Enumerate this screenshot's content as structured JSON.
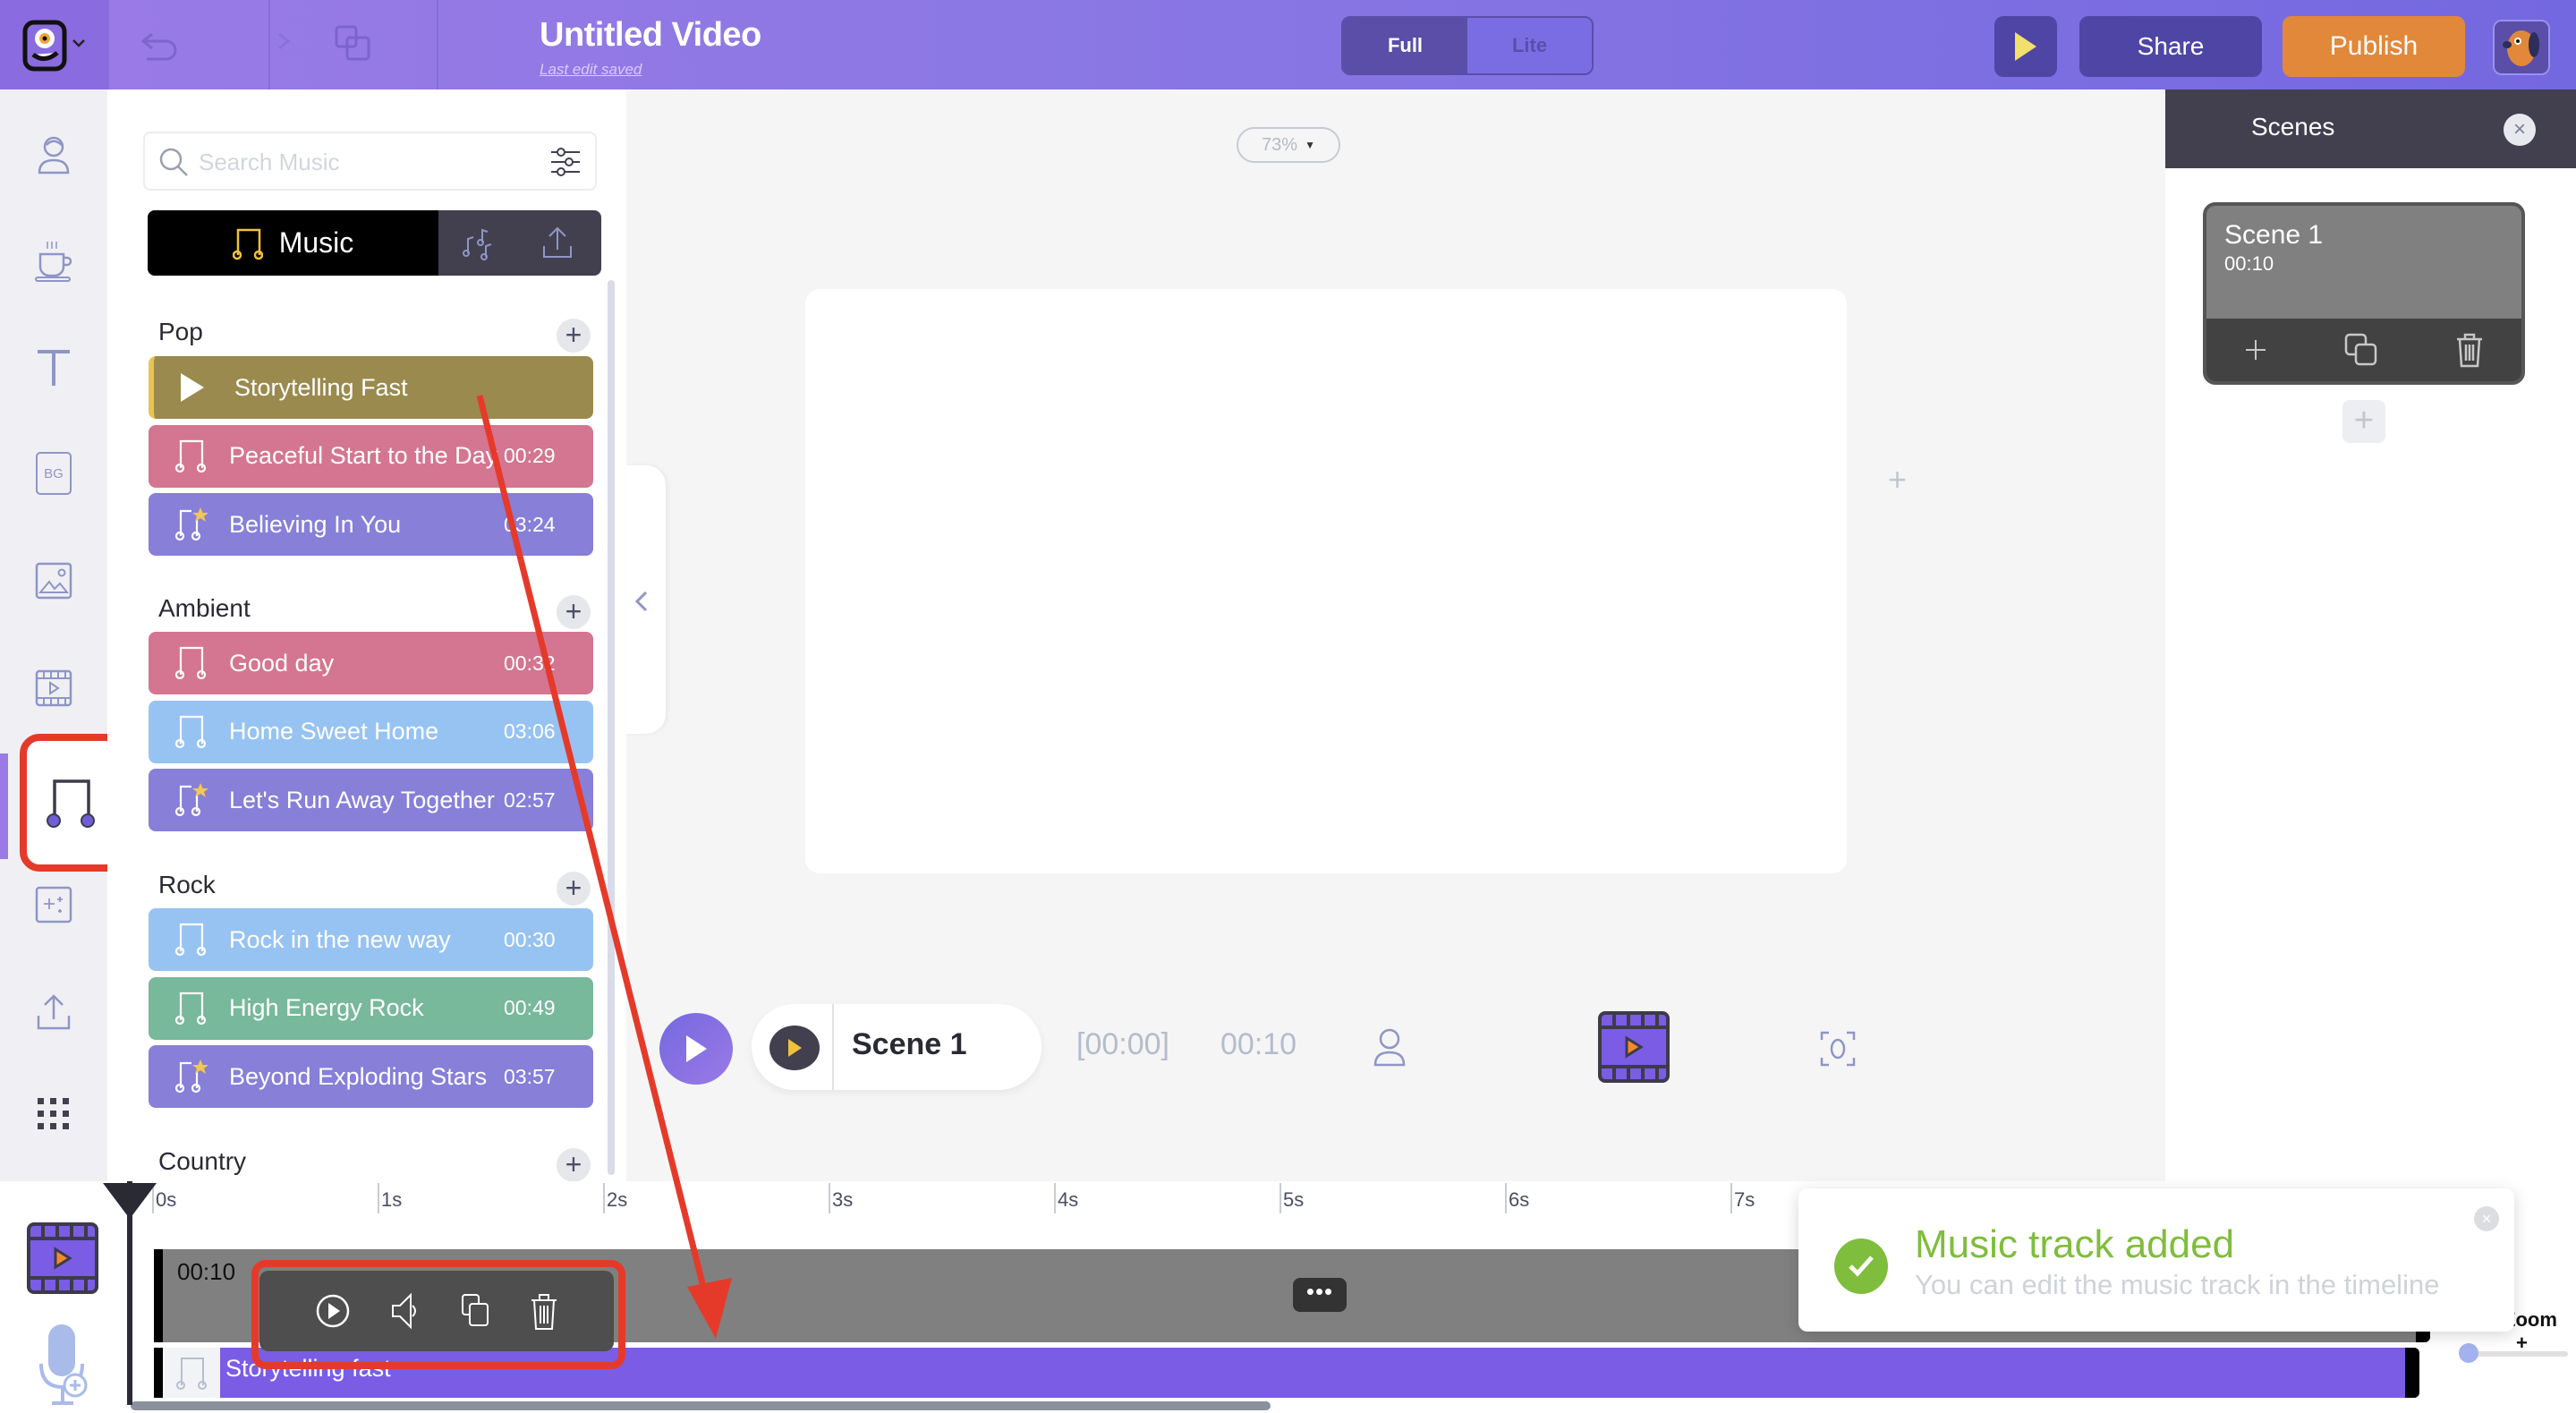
{
  "header": {
    "title": "Untitled Video",
    "save_status": "Last edit saved",
    "mode_options": [
      "Full",
      "Lite"
    ],
    "mode_selected": "Full",
    "share_label": "Share",
    "publish_label": "Publish",
    "icons": [
      "app-logo-icon",
      "undo-icon",
      "redo-icon",
      "duplicate-icon",
      "preview-play-icon",
      "user-avatar"
    ]
  },
  "rail": {
    "items": [
      {
        "name": "characters",
        "icon": "character-icon"
      },
      {
        "name": "properties",
        "icon": "coffee-cup-icon"
      },
      {
        "name": "text",
        "icon": "text-icon"
      },
      {
        "name": "background",
        "icon": "bg-icon",
        "label": "BG"
      },
      {
        "name": "images",
        "icon": "image-icon"
      },
      {
        "name": "videos",
        "icon": "video-icon"
      },
      {
        "name": "music",
        "icon": "music-note-icon",
        "active": true
      },
      {
        "name": "effects",
        "icon": "sparkle-icon"
      },
      {
        "name": "upload",
        "icon": "upload-icon"
      },
      {
        "name": "more",
        "icon": "grid-icon"
      }
    ]
  },
  "music_panel": {
    "search_placeholder": "Search Music",
    "tabs": [
      {
        "label": "Music",
        "active": true
      },
      {
        "label": "",
        "icon": "sound-effects-icon"
      },
      {
        "label": "",
        "icon": "upload-icon"
      }
    ],
    "categories": [
      {
        "name": "Pop",
        "tracks": [
          {
            "name": "Storytelling Fast",
            "duration": "",
            "color": "#9a8a4e",
            "premium": false,
            "playing": true
          },
          {
            "name": "Peaceful Start to the Day",
            "duration": "00:29",
            "color": "#d47591",
            "premium": false
          },
          {
            "name": "Believing In You",
            "duration": "03:24",
            "color": "#877fd8",
            "premium": true
          }
        ]
      },
      {
        "name": "Ambient",
        "tracks": [
          {
            "name": "Good day",
            "duration": "00:32",
            "color": "#d47591",
            "premium": false
          },
          {
            "name": "Home Sweet Home",
            "duration": "03:06",
            "color": "#97c3f2",
            "premium": false
          },
          {
            "name": "Let's Run Away Together",
            "duration": "02:57",
            "color": "#877fd8",
            "premium": true
          }
        ]
      },
      {
        "name": "Rock",
        "tracks": [
          {
            "name": "Rock in the new way",
            "duration": "00:30",
            "color": "#97c3f2",
            "premium": false
          },
          {
            "name": "High Energy Rock",
            "duration": "00:49",
            "color": "#78b89b",
            "premium": false
          },
          {
            "name": "Beyond Exploding Stars",
            "duration": "03:57",
            "color": "#877fd8",
            "premium": true
          }
        ]
      },
      {
        "name": "Country",
        "tracks": []
      }
    ]
  },
  "canvas": {
    "zoom_level": "73%"
  },
  "scenes_panel": {
    "title": "Scenes",
    "scenes": [
      {
        "name": "Scene 1",
        "duration": "00:10"
      }
    ]
  },
  "player": {
    "scene_label": "Scene 1",
    "current_time": "[00:00]",
    "total_time": "00:10"
  },
  "timeline": {
    "ruler": [
      "0s",
      "1s",
      "2s",
      "3s",
      "4s",
      "5s",
      "6s",
      "7s"
    ],
    "scene_track_duration": "00:10",
    "more_label": "•••",
    "music_track_name": "Storytelling fast",
    "zoom_label": "Zoom",
    "zoom_plus": "+",
    "zoom_value": 0
  },
  "toast": {
    "title": "Music track added",
    "message": "You can edit the music track in the timeline",
    "close": "×"
  },
  "colors": {
    "accent": "#7b5ce5",
    "publish": "#e2883a",
    "success": "#7fbd3d",
    "annotation": "#e53a2a"
  }
}
